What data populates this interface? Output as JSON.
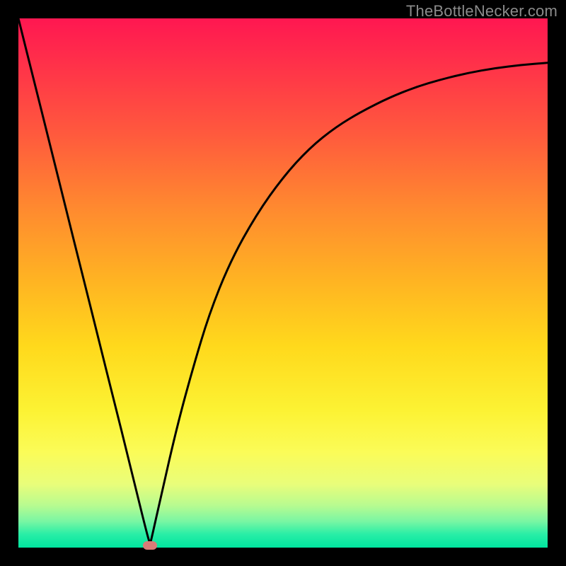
{
  "watermark": "TheBottleNecker.com",
  "chart_data": {
    "type": "line",
    "title": "",
    "xlabel": "",
    "ylabel": "",
    "xlim": [
      0,
      100
    ],
    "ylim": [
      0,
      100
    ],
    "x": [
      0,
      3,
      6,
      9,
      12,
      15,
      18,
      21,
      24.8,
      25,
      27,
      30,
      33,
      36,
      40,
      45,
      50,
      55,
      60,
      65,
      70,
      75,
      80,
      85,
      90,
      95,
      100
    ],
    "values": [
      100,
      88,
      76,
      64,
      52,
      40,
      28,
      16,
      0.5,
      1,
      10,
      23,
      34,
      44,
      54,
      63,
      70,
      75.5,
      79.5,
      82.5,
      85,
      87,
      88.5,
      89.7,
      90.6,
      91.2,
      91.6
    ],
    "optimum_x": 24.8,
    "annotations": [
      {
        "type": "marker",
        "x": 24.8,
        "y": 0,
        "shape": "pill",
        "color": "#d87b77"
      }
    ],
    "gradient_stops": [
      {
        "pos": 0.0,
        "color": "#ff1751"
      },
      {
        "pos": 0.5,
        "color": "#ffb522"
      },
      {
        "pos": 0.8,
        "color": "#fbfc58"
      },
      {
        "pos": 1.0,
        "color": "#00e59f"
      }
    ]
  }
}
